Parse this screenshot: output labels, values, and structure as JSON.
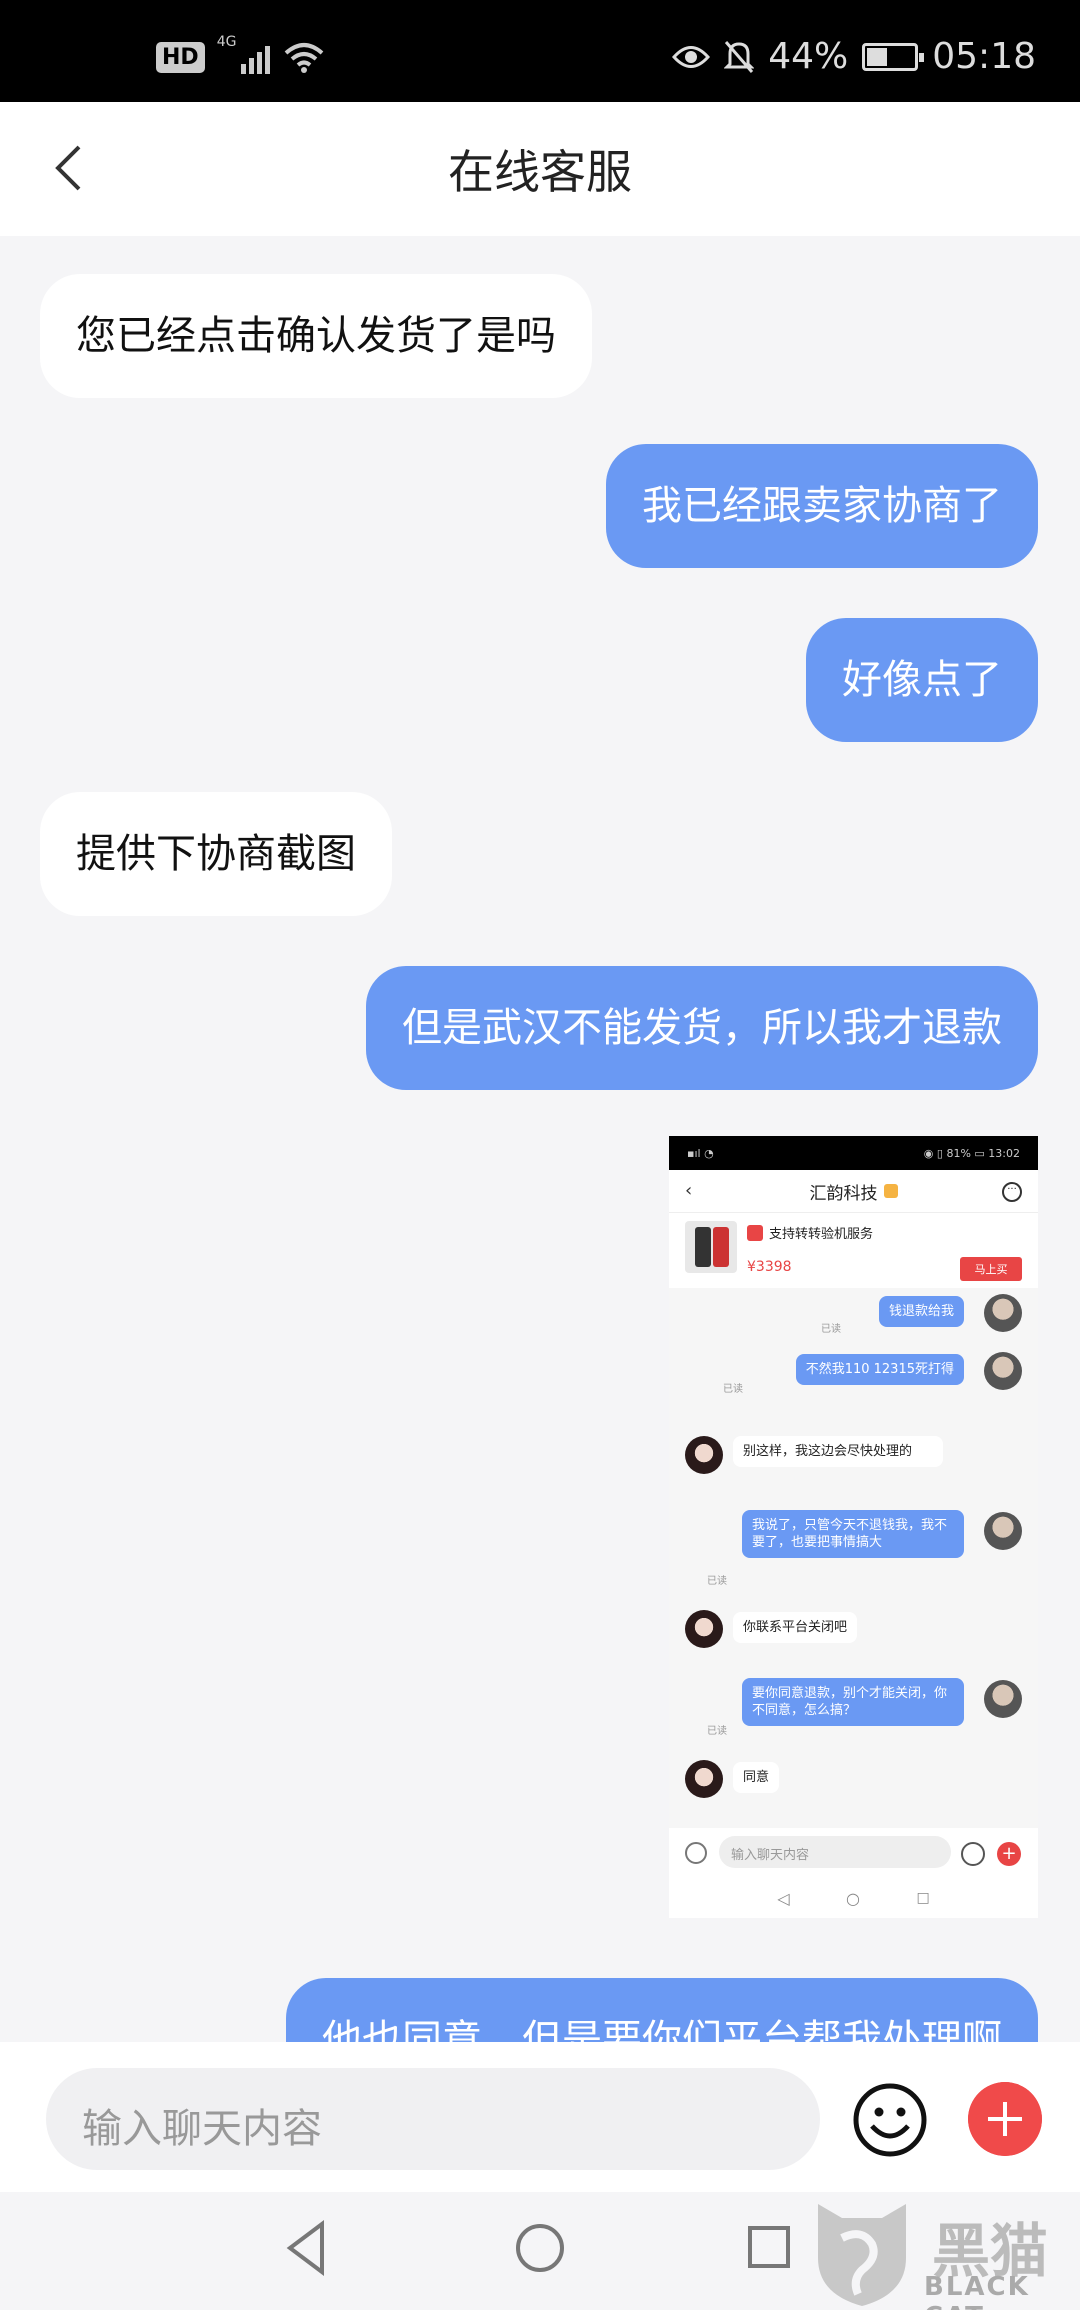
{
  "status_bar": {
    "hd": "HD",
    "network": "4G",
    "battery_percent": "44%",
    "time": "05:18",
    "battery_level": 0.44
  },
  "header": {
    "title": "在线客服"
  },
  "messages": [
    {
      "side": "left",
      "text": "您已经点击确认发货了是吗"
    },
    {
      "side": "right",
      "text": "我已经跟卖家协商了"
    },
    {
      "side": "right",
      "text": "好像点了"
    },
    {
      "side": "left",
      "text": "提供下协商截图"
    },
    {
      "side": "right",
      "text": "但是武汉不能发货，所以我才退款"
    },
    {
      "side": "right",
      "text": "他也同意，但是要你们平台帮我处理啊"
    }
  ],
  "screenshot": {
    "status_battery": "81%",
    "status_time": "13:02",
    "title": "汇韵科技",
    "product_tag": "支持转转验机服务",
    "product_price": "¥3398",
    "buy_label": "马上买",
    "messages": [
      {
        "side": "right",
        "text": "钱退款给我",
        "read": "已读"
      },
      {
        "side": "right",
        "text": "不然我110  12315死打得",
        "read": "已读"
      },
      {
        "side": "left",
        "text": "别这样，我这边会尽快处理的"
      },
      {
        "side": "right",
        "text": "我说了，只管今天不退钱我，我不要了，也要把事情搞大",
        "read": "已读"
      },
      {
        "side": "left",
        "text": "你联系平台关闭吧"
      },
      {
        "side": "right",
        "text": "要你同意退款，别个才能关闭，你不同意，怎么搞？",
        "read": "已读"
      },
      {
        "side": "left",
        "text": "同意"
      }
    ],
    "input_placeholder": "输入聊天内容"
  },
  "input": {
    "placeholder": "输入聊天内容"
  },
  "watermark": {
    "cn": "黑猫",
    "en": "BLACK CAT"
  },
  "colors": {
    "bubble_right": "#6a99f3",
    "bubble_left": "#ffffff",
    "plus_button": "#f04a4a",
    "background": "#f5f5f7"
  }
}
